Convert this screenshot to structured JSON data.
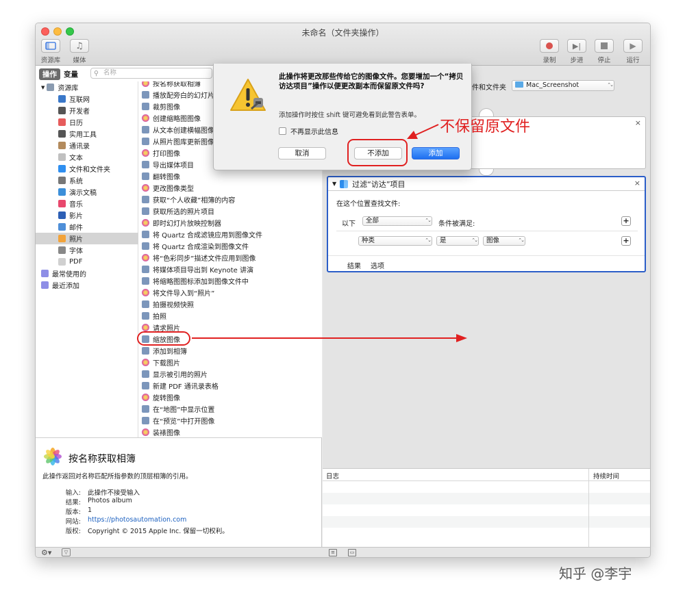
{
  "window": {
    "title": "未命名（文件夹操作）"
  },
  "toolbar": {
    "library_label": "资源库",
    "media_label": "媒体",
    "record_label": "录制",
    "step_label": "步进",
    "stop_label": "停止",
    "run_label": "运行"
  },
  "library_tabs": {
    "actions": "操作",
    "variables": "变量"
  },
  "search": {
    "placeholder": "名称"
  },
  "library": [
    {
      "label": "资源库",
      "icon": "library-folder-icon",
      "indent": 0
    },
    {
      "label": "互联网",
      "icon": "globe-icon",
      "indent": 1
    },
    {
      "label": "开发者",
      "icon": "tools-icon",
      "indent": 1
    },
    {
      "label": "日历",
      "icon": "calendar-icon",
      "indent": 1
    },
    {
      "label": "实用工具",
      "icon": "tools-icon",
      "indent": 1
    },
    {
      "label": "通讯录",
      "icon": "contacts-icon",
      "indent": 1
    },
    {
      "label": "文本",
      "icon": "text-icon",
      "indent": 1
    },
    {
      "label": "文件和文件夹",
      "icon": "finder-icon",
      "indent": 1
    },
    {
      "label": "系统",
      "icon": "system-icon",
      "indent": 1
    },
    {
      "label": "演示文稿",
      "icon": "presentation-icon",
      "indent": 1
    },
    {
      "label": "音乐",
      "icon": "music-icon",
      "indent": 1
    },
    {
      "label": "影片",
      "icon": "movie-icon",
      "indent": 1
    },
    {
      "label": "邮件",
      "icon": "mail-icon",
      "indent": 1
    },
    {
      "label": "照片",
      "icon": "photos-icon",
      "indent": 1,
      "selected": true
    },
    {
      "label": "字体",
      "icon": "font-icon",
      "indent": 1
    },
    {
      "label": "PDF",
      "icon": "pdf-icon",
      "indent": 1
    },
    {
      "label": "最常使用的",
      "icon": "smart-folder-icon",
      "indent": 0
    },
    {
      "label": "最近添加",
      "icon": "smart-folder-icon",
      "indent": 0
    }
  ],
  "actions": [
    "按名称获取相簿",
    "播放配旁白的幻灯片",
    "裁剪图像",
    "创建缩略图图像",
    "从文本创建横幅图像",
    "从照片图库更新图像",
    "打印图像",
    "导出媒体项目",
    "翻转图像",
    "更改图像类型",
    "获取“个人收藏”相簿的内容",
    "获取所选的照片项目",
    "即时幻灯片放映控制器",
    "将 Quartz 合成滤镜应用到图像文件",
    "将 Quartz 合成渲染到图像文件",
    "将“色彩同步”描述文件应用到图像",
    "将媒体项目导出到 Keynote 讲演",
    "将缩略图图标添加到图像文件中",
    "将文件导入到“照片”",
    "拍摄视频快照",
    "拍照",
    "请求照片",
    "缩放图像",
    "添加到相簿",
    "下载图片",
    "显示被引用的照片",
    "新建 PDF 通讯录表格",
    "旋转图像",
    "在“地图”中显示位置",
    "在“预览”中打开图像",
    "装裱图像"
  ],
  "description": {
    "title": "按名称获取相簿",
    "text": "此操作返回对名称匹配所指参数的顶层相簿的引用。",
    "input_key": "输入:",
    "input_val": "此操作不接受输入",
    "result_key": "结果:",
    "result_val": "Photos album",
    "version_key": "版本:",
    "version_val": "1",
    "website_key": "网站:",
    "website_val": "https://photosautomation.com",
    "copyright_key": "版权:",
    "copyright_val": "Copyright © 2015 Apple Inc. 保留一切权利。"
  },
  "workflow": {
    "folder_label": "件和文件夹",
    "folder_value": "Mac_Screenshot",
    "card": {
      "title": "过滤“访达”项目",
      "search_location": "在这个位置查找文件:",
      "prefix": "以下",
      "match": "全部",
      "suffix": "条件被满足:",
      "criterion": "种类",
      "operator": "是",
      "value": "图像",
      "tab_results": "结果",
      "tab_options": "选项"
    }
  },
  "log": {
    "col_log": "日志",
    "col_duration": "持续时间"
  },
  "dialog": {
    "message": "此操作将更改那些传给它的图像文件。您要增加一个“拷贝访达项目”操作以便更改副本而保留原文件吗?",
    "info": "添加操作时按住 shift 键可避免看到此警告表单。",
    "checkbox": "不再显示此信息",
    "cancel": "取消",
    "dont_add": "不添加",
    "add": "添加"
  },
  "annotation": {
    "text": "不保留原文件"
  },
  "watermark": {
    "text": "知乎 @李宇"
  },
  "colors": {
    "accent": "#2a5dc8",
    "annotation_red": "#e02020"
  }
}
